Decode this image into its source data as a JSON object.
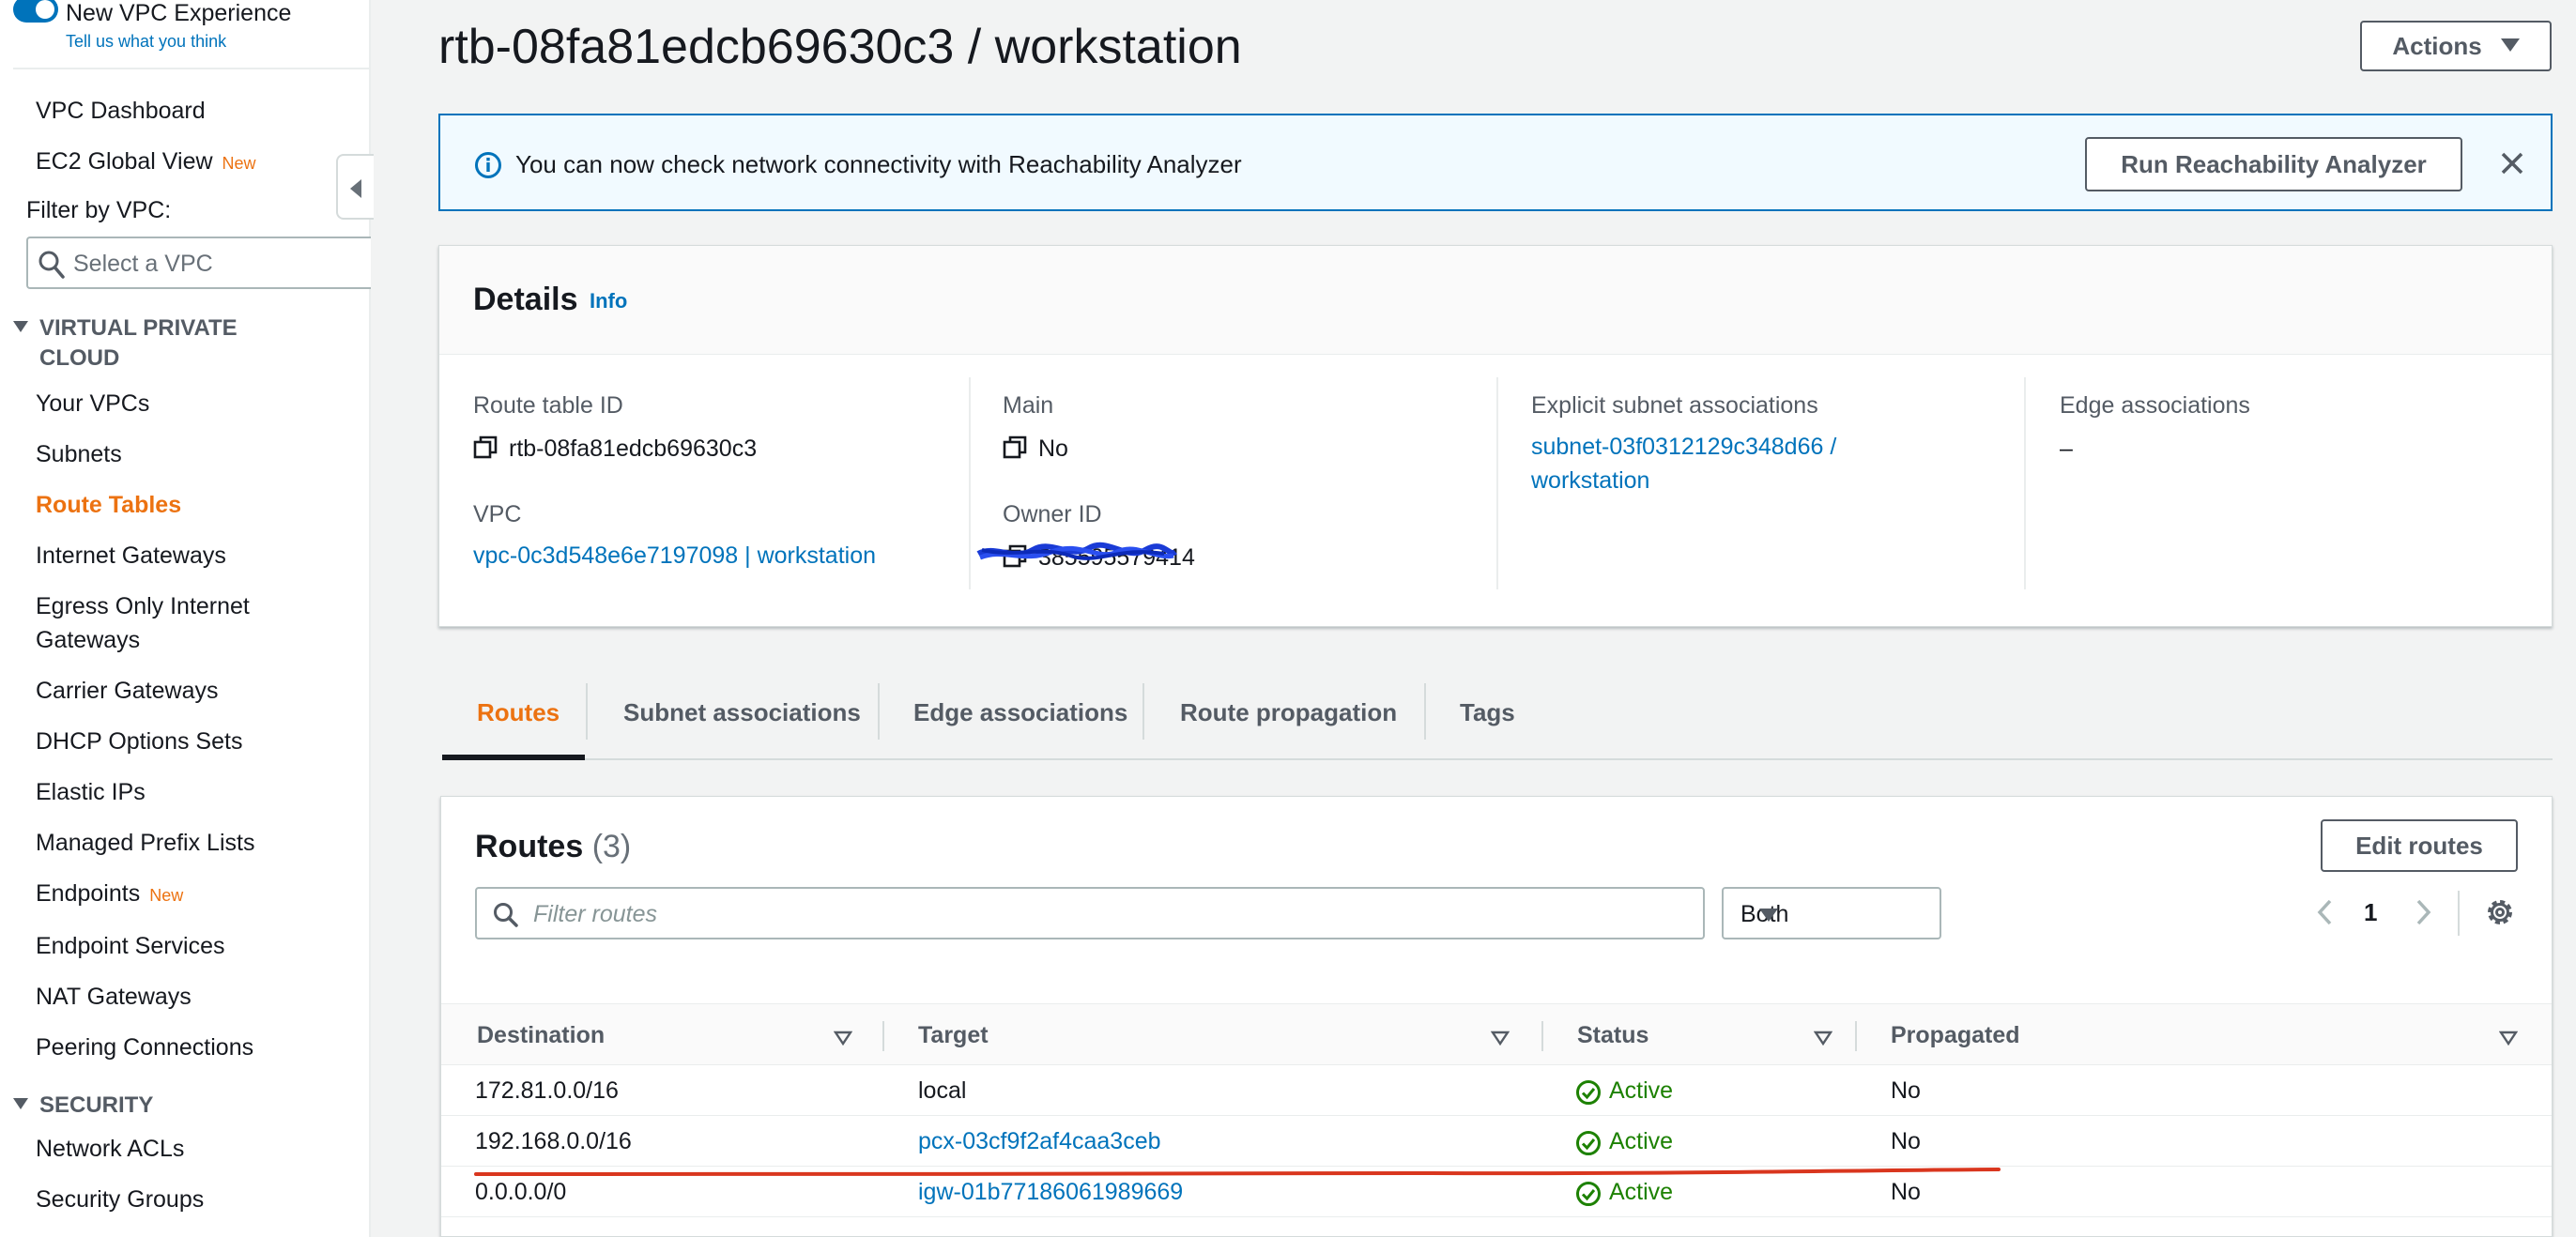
{
  "sidebar": {
    "experience_label": "New VPC Experience",
    "feedback_link": "Tell us what you think",
    "top_items": [
      {
        "label": "VPC Dashboard"
      },
      {
        "label": "EC2 Global View",
        "badge": "New"
      }
    ],
    "filter_label": "Filter by VPC:",
    "filter_placeholder": "Select a VPC",
    "section_vpc_line1": "VIRTUAL PRIVATE",
    "section_vpc_line2": "CLOUD",
    "vpc_items": [
      {
        "label": "Your VPCs"
      },
      {
        "label": "Subnets"
      },
      {
        "label": "Route Tables"
      },
      {
        "label": "Internet Gateways"
      },
      {
        "label": "Egress Only Internet"
      },
      {
        "label": "Gateways"
      },
      {
        "label": "Carrier Gateways"
      },
      {
        "label": "DHCP Options Sets"
      },
      {
        "label": "Elastic IPs"
      },
      {
        "label": "Managed Prefix Lists"
      },
      {
        "label": "Endpoints",
        "badge": "New"
      },
      {
        "label": "Endpoint Services"
      },
      {
        "label": "NAT Gateways"
      },
      {
        "label": "Peering Connections"
      }
    ],
    "section_security": "SECURITY",
    "security_items": [
      {
        "label": "Network ACLs"
      },
      {
        "label": "Security Groups"
      }
    ]
  },
  "header": {
    "title": "rtb-08fa81edcb69630c3 / workstation",
    "actions_label": "Actions"
  },
  "banner": {
    "message": "You can now check network connectivity with Reachability Analyzer",
    "button_label": "Run Reachability Analyzer"
  },
  "details": {
    "title": "Details",
    "info_label": "Info",
    "route_table_id_label": "Route table ID",
    "route_table_id": "rtb-08fa81edcb69630c3",
    "vpc_label": "VPC",
    "vpc_value": "vpc-0c3d548e6e7197098 | workstation",
    "main_label": "Main",
    "main_value": "No",
    "owner_label": "Owner ID",
    "owner_value": "385595579414",
    "subnet_label": "Explicit subnet associations",
    "subnet_value_line1": "subnet-03f0312129c348d66 /",
    "subnet_value_line2": "workstation",
    "edge_label": "Edge associations",
    "edge_value": "–"
  },
  "tabs": [
    {
      "label": "Routes"
    },
    {
      "label": "Subnet associations"
    },
    {
      "label": "Edge associations"
    },
    {
      "label": "Route propagation"
    },
    {
      "label": "Tags"
    }
  ],
  "routes": {
    "title": "Routes",
    "count": "(3)",
    "edit_label": "Edit routes",
    "filter_placeholder": "Filter routes",
    "filter_select": "Both",
    "page": "1",
    "columns": [
      "Destination",
      "Target",
      "Status",
      "Propagated"
    ],
    "rows": [
      {
        "destination": "172.81.0.0/16",
        "target": "local",
        "status": "Active",
        "propagated": "No"
      },
      {
        "destination": "192.168.0.0/16",
        "target": "pcx-03cf9f2af4caa3ceb",
        "status": "Active",
        "propagated": "No"
      },
      {
        "destination": "0.0.0.0/0",
        "target": "igw-01b77186061989669",
        "status": "Active",
        "propagated": "No"
      }
    ]
  },
  "colors": {
    "accent_orange": "#ec7211",
    "link_blue": "#0073bb",
    "success_green": "#1d8102",
    "annotation_red": "#d9361e"
  }
}
